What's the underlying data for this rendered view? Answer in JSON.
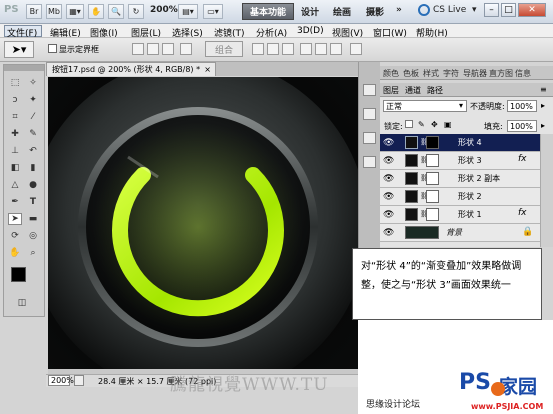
{
  "titlebar": {
    "app_logo": "PS",
    "zoom": "200%",
    "workspace_active": "基本功能",
    "workspaces": [
      "设计",
      "绘画",
      "摄影"
    ],
    "more": "»",
    "cs_live": "CS Live",
    "minimize": "–",
    "restore": "□",
    "close": "✕"
  },
  "menubar": {
    "items": [
      "文件(F)",
      "编辑(E)",
      "图像(I)",
      "图层(L)",
      "选择(S)",
      "滤镜(T)",
      "分析(A)",
      "3D(D)",
      "视图(V)",
      "窗口(W)",
      "帮助(H)"
    ]
  },
  "options": {
    "show_transform_controls": "显示定界框",
    "combine": "组合"
  },
  "document": {
    "tab_title": "按钮17.psd @ 200% (形状 4, RGB/8) *",
    "tab_close": "×",
    "zoom": "200%",
    "size": "28.4 厘米 × 15.7 厘米 (72 ppi)"
  },
  "panels": {
    "top_tabs": [
      "颜色",
      "色板",
      "样式",
      "字符",
      "导航器",
      "直方图",
      "信息"
    ],
    "layers_tabs": [
      "图层",
      "通道",
      "路径"
    ],
    "blend_mode": "正常",
    "opacity_label": "不透明度:",
    "opacity_value": "100%",
    "lock_label": "锁定:",
    "fill_label": "填充:",
    "fill_value": "100%",
    "layers": [
      {
        "name": "形状 4",
        "selected": true,
        "fx": false,
        "bg": false
      },
      {
        "name": "形状 3",
        "selected": false,
        "fx": true,
        "bg": false
      },
      {
        "name": "形状 2 副本",
        "selected": false,
        "fx": false,
        "bg": false
      },
      {
        "name": "形状 2",
        "selected": false,
        "fx": false,
        "bg": false
      },
      {
        "name": "形状 1",
        "selected": false,
        "fx": true,
        "bg": false
      },
      {
        "name": "背景",
        "selected": false,
        "fx": false,
        "bg": true
      }
    ],
    "fx_label": "fx"
  },
  "callout": {
    "text": "对“形状 4”的“渐变叠加”效果略做调整，使之与“形状 3”画面效果统一"
  },
  "watermark": {
    "text": "騰龍視覺WWW.TU",
    "caption": "思缘设计论坛"
  },
  "logo": {
    "ps": "PS",
    "jia": "家园",
    "url": "www.PSJIA.COM"
  },
  "colors": {
    "glow_green": "#b8f000",
    "selected_layer": "#121f52",
    "workspace_active_bg": "#6b7078"
  }
}
